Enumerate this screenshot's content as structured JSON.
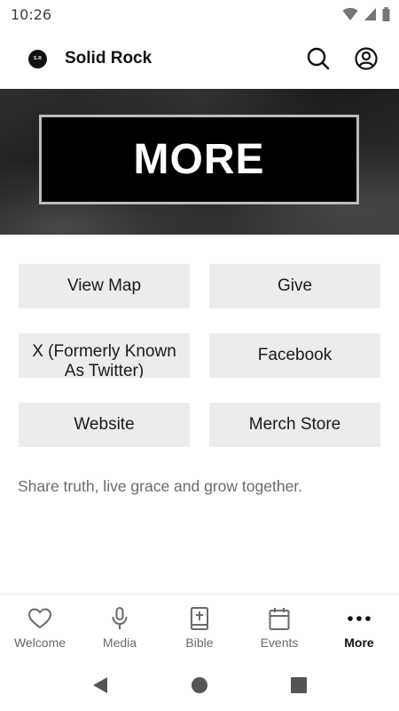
{
  "status_bar": {
    "time": "10:26"
  },
  "header": {
    "logo_text": "S.R",
    "title": "Solid Rock"
  },
  "hero": {
    "title": "MORE"
  },
  "links": [
    {
      "label": "View Map",
      "name": "view-map-button"
    },
    {
      "label": "Give",
      "name": "give-button"
    },
    {
      "label": "X (Formerly Known As Twitter)",
      "name": "x-twitter-button"
    },
    {
      "label": "Facebook",
      "name": "facebook-button"
    },
    {
      "label": "Website",
      "name": "website-button"
    },
    {
      "label": "Merch Store",
      "name": "merch-store-button"
    }
  ],
  "tagline": "Share truth, live grace and grow together.",
  "bottom_nav": [
    {
      "label": "Welcome",
      "icon": "heart-icon",
      "active": false
    },
    {
      "label": "Media",
      "icon": "microphone-icon",
      "active": false
    },
    {
      "label": "Bible",
      "icon": "bible-icon",
      "active": false
    },
    {
      "label": "Events",
      "icon": "calendar-icon",
      "active": false
    },
    {
      "label": "More",
      "icon": "more-dots-icon",
      "active": true
    }
  ],
  "colors": {
    "button_bg": "#ececee",
    "hero_box": "#000000",
    "active_nav": "#111111",
    "inactive_nav": "#6a6a6a"
  }
}
